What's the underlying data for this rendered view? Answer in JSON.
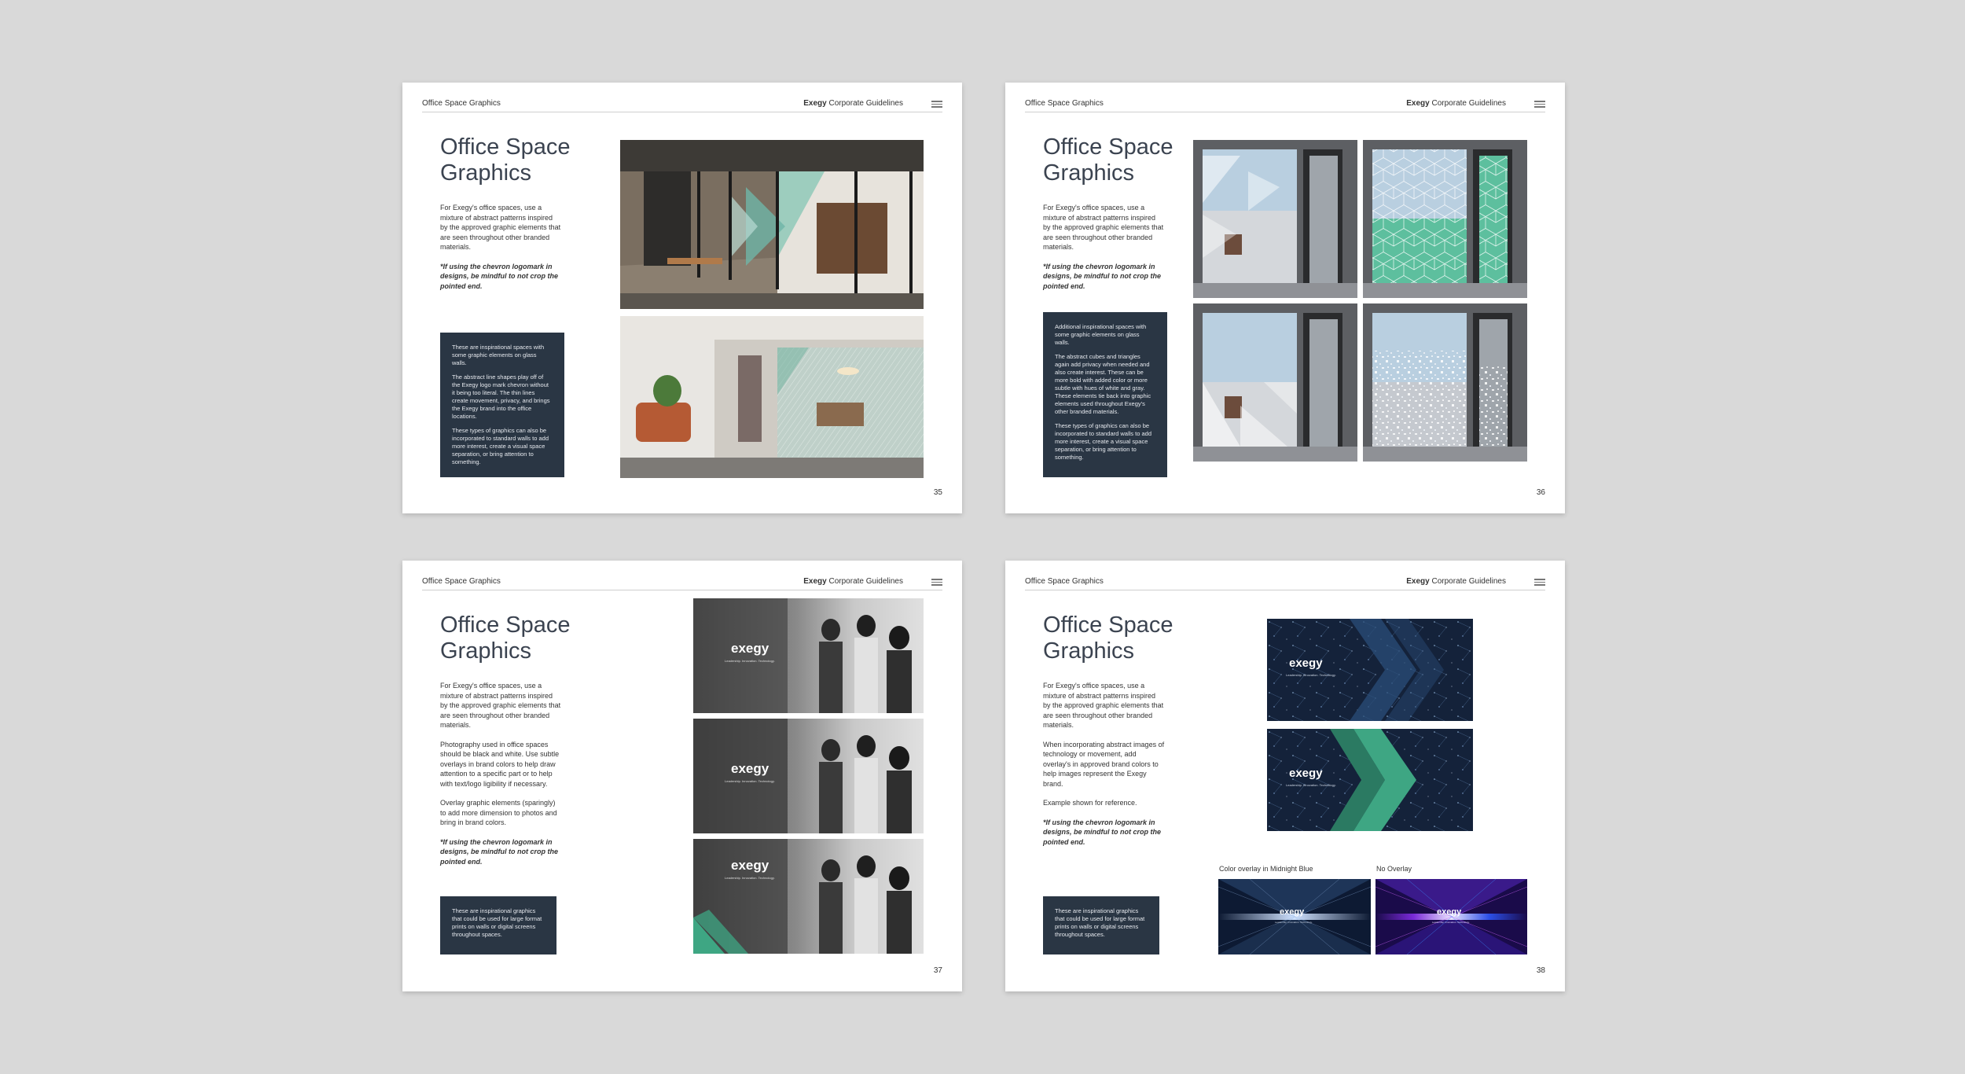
{
  "header": {
    "section": "Office Space Graphics",
    "brand": "Exegy",
    "doc": "Corporate Guidelines"
  },
  "title_line1": "Office Space",
  "title_line2": "Graphics",
  "shared": {
    "intro": "For Exegy's office spaces, use a mixture of abstract patterns inspired by the approved graphic elements that are seen throughout other branded materials.",
    "note": "*If using the chevron logomark in designs, be mindful to not crop the pointed end."
  },
  "page35": {
    "number": "35",
    "box": [
      "These are inspirational spaces with some graphic elements on glass walls.",
      "The abstract line shapes play off of the Exegy logo mark chevron without it being too literal. The thin lines create movement, privacy, and brings the Exegy brand into the office locations.",
      "These types of graphics can also be incorporated to standard walls to add more interest, create a visual space separation, or bring attention to something."
    ]
  },
  "page36": {
    "number": "36",
    "box": [
      "Additional inspirational spaces with some graphic elements on glass walls.",
      "The abstract cubes and triangles again add privacy when needed and also create interest. These can be more bold with added color or more subtle with hues of white and gray. These elements tie back into graphic elements used throughout Exegy's other branded materials.",
      "These types of graphics can also be incorporated to standard walls to add more interest, create a visual space separation, or bring attention to something."
    ]
  },
  "page37": {
    "number": "37",
    "para2": "Photography used in office spaces should be black and white. Use subtle overlays in brand colors to help draw attention to a specific part or to help with text/logo ligibility if necessary.",
    "para3": "Overlay graphic elements (sparingly) to add more dimension to photos and bring in brand colors.",
    "box": "These are inspirational graphics that could be used for large format prints on walls or digital screens throughout spaces.",
    "logo": "exegy",
    "tagline": "Leadership. Innovation. Technology."
  },
  "page38": {
    "number": "38",
    "para2": "When incorporating abstract images of technology or movement, add overlay's in approved brand colors to help images represent the Exegy brand.",
    "para3": "Example shown for reference.",
    "box": "These are inspirational graphics that could be used for large format prints on walls or digital screens throughout spaces.",
    "caption1": "Color overlay in Midnight Blue",
    "caption2": "No Overlay",
    "logo": "exegy",
    "tagline": "Leadership. Innovation. Technology."
  },
  "colors": {
    "midnight": "#1b2a44",
    "green": "#3ea683",
    "darkbox": "#2a3644"
  }
}
